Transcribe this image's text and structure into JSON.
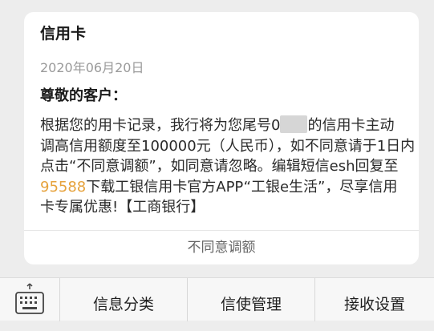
{
  "message": {
    "title": "信用卡",
    "date": "2020年06月20日",
    "greeting": "尊敬的客户：",
    "lines": [
      {
        "text_before": "根据您的用卡记录，我行将为您尾号0",
        "text_after": "的信用卡主动"
      },
      {
        "text": "调高信用额度至100000元（人民币），如不同意请于1日内"
      },
      {
        "text": "点击“不同意调额”，如同意请忽略。编辑短信esh回复至"
      },
      {
        "number": "95588",
        "text": "下载工银信用卡官方APP“工银e生活”，尽享信用"
      },
      {
        "text": "卡专属优惠!【工商银行】"
      }
    ],
    "action_label": "不同意调额"
  },
  "bottom_menu": {
    "items": [
      "信息分类",
      "信使管理",
      "接收设置"
    ]
  },
  "colors": {
    "highlight": "#e6a23c"
  }
}
